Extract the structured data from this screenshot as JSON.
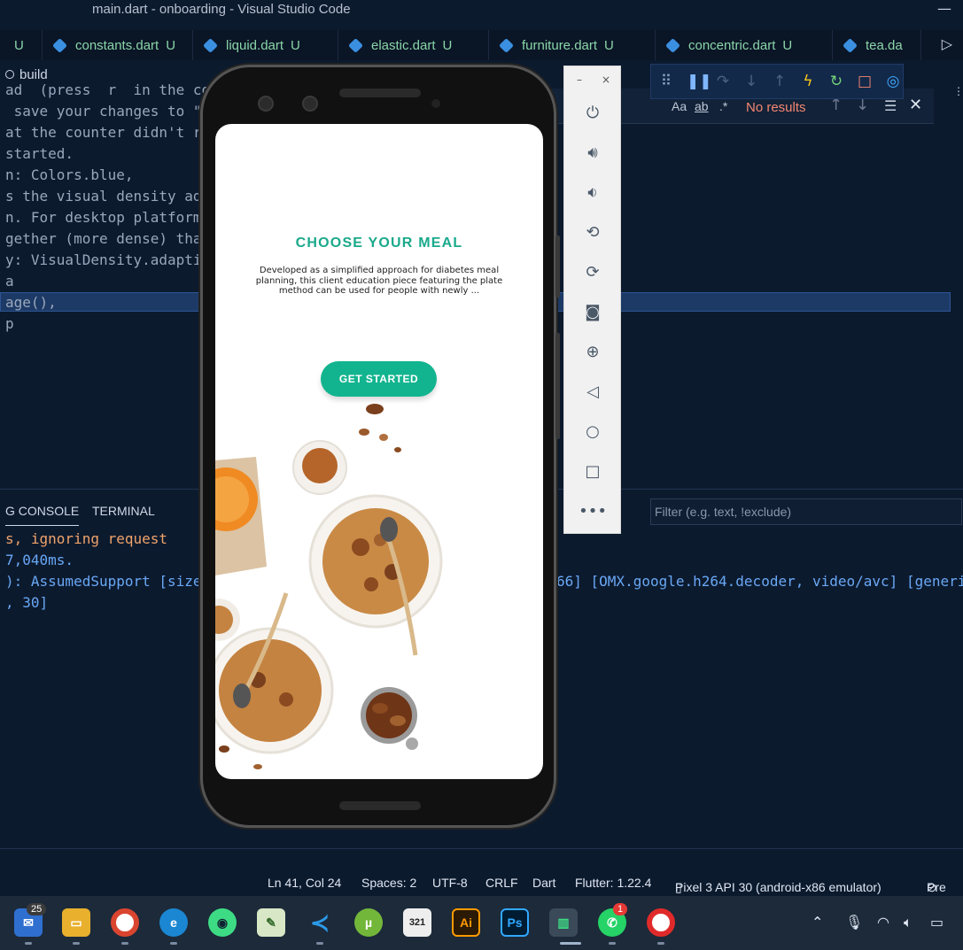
{
  "window": {
    "title": "main.dart - onboarding - Visual Studio Code",
    "minimize_glyph": "—"
  },
  "tabs": [
    {
      "label": "",
      "status": "U"
    },
    {
      "label": "constants.dart",
      "status": "U"
    },
    {
      "label": "liquid.dart",
      "status": "U"
    },
    {
      "label": "elastic.dart",
      "status": "U"
    },
    {
      "label": "furniture.dart",
      "status": "U"
    },
    {
      "label": "concentric.dart",
      "status": "U"
    },
    {
      "label": "tea.da",
      "status": ""
    }
  ],
  "breadcrumb": {
    "label": "build"
  },
  "editor": {
    "lines": [
      "ad  (press  r  in the co",
      " save your changes to \"",
      "at the counter didn't r",
      "started.",
      "n: Colors.blue,",
      "s the visual density ad",
      "n. For desktop platform",
      "gether (more dense) tha",
      "y: VisualDensity.adapti",
      "a",
      "age(),",
      "p"
    ]
  },
  "find": {
    "match_case": "Aa",
    "whole_word": "ab",
    "regex": ".*",
    "result": "No results"
  },
  "debug_toolbar": {
    "icons": [
      "drag-handle-icon",
      "pause-icon",
      "step-over-icon",
      "step-into-icon",
      "step-out-icon",
      "hot-reload-icon",
      "restart-icon",
      "stop-icon",
      "devtools-icon"
    ]
  },
  "panel": {
    "tabs": [
      "G CONSOLE",
      "TERMINAL"
    ],
    "filter_placeholder": "Filter (e.g. text, !exclude)",
    "console": [
      "s, ignoring request",
      "7,040ms.",
      "): AssumedSupport [size",
      ", 30]"
    ],
    "console_right": "66] [OMX.google.h264.decoder, video/avc] [generi"
  },
  "statusbar": {
    "position": "Ln 41, Col 24",
    "spaces": "Spaces: 2",
    "encoding": "UTF-8",
    "eol": "CRLF",
    "language": "Dart",
    "flutter": "Flutter: 1.22.4",
    "device": "Pixel 3 API 30 (android-x86 emulator)",
    "extra": "Pre"
  },
  "emulator": {
    "window_controls": [
      "–",
      "×"
    ],
    "tools": [
      "power-icon",
      "volume-up-icon",
      "volume-down-icon",
      "rotate-left-icon",
      "rotate-right-icon",
      "camera-icon",
      "zoom-icon",
      "back-icon",
      "home-icon",
      "overview-icon",
      "more-icon"
    ]
  },
  "app": {
    "title": "CHOOSE YOUR MEAL",
    "description": "Developed as a simplified approach for diabetes meal planning, this client education piece featuring the plate method can be used for people with newly ...",
    "cta": "GET STARTED"
  },
  "taskbar": {
    "mail_badge": "25",
    "whatsapp_badge": "1",
    "apps": [
      "mail-icon",
      "file-explorer-icon",
      "chrome-icon",
      "edge-icon",
      "android-studio-icon",
      "notepad-icon",
      "vscode-icon",
      "utorrent-icon",
      "video-editor-icon",
      "illustrator-icon",
      "photoshop-icon",
      "emulator-icon",
      "whatsapp-icon",
      "recorder-icon"
    ],
    "illustrator_label": "Ai",
    "photoshop_label": "Ps"
  },
  "colors": {
    "accent": "#1aa98b",
    "button": "#12b48f",
    "editor_bg": "#0c1a2e",
    "highlight": "#1d3a66",
    "no_results": "#f48771"
  }
}
